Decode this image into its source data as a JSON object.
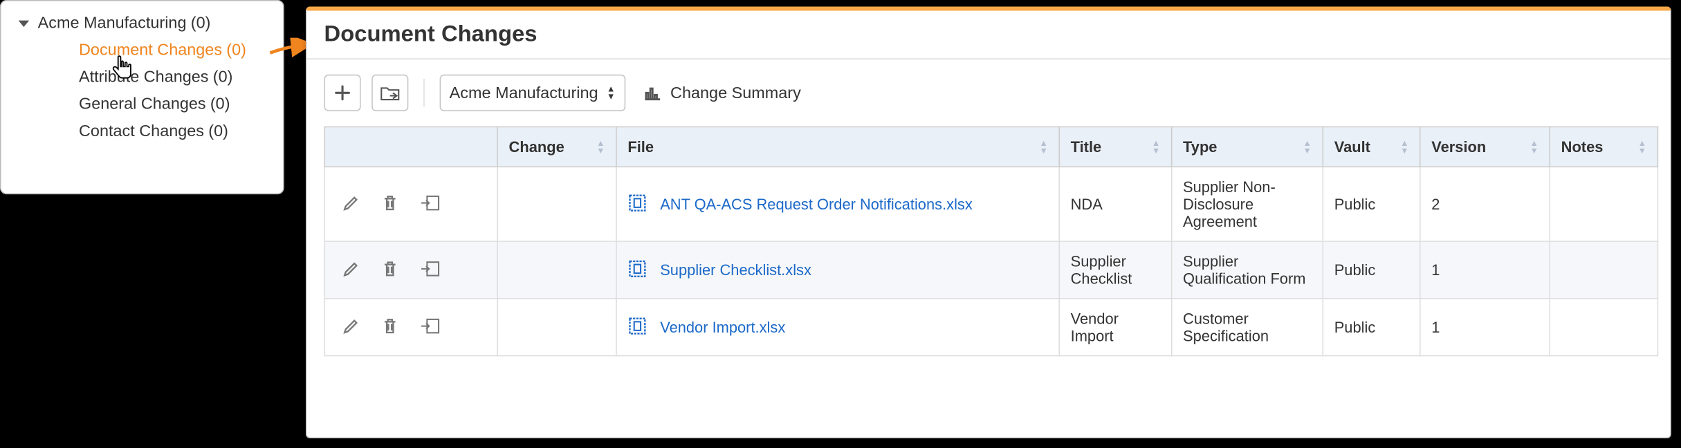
{
  "tree": {
    "root": {
      "label": "Acme Manufacturing",
      "count": "(0)",
      "expanded": true
    },
    "children": [
      {
        "label": "Document Changes",
        "count": "(0)",
        "selected": true
      },
      {
        "label": "Attribute Changes",
        "count": "(0)"
      },
      {
        "label": "General Changes",
        "count": "(0)"
      },
      {
        "label": "Contact Changes",
        "count": "(0)"
      }
    ]
  },
  "main": {
    "title": "Document Changes",
    "toolbar": {
      "select_value": "Acme Manufacturing",
      "summary_label": "Change Summary"
    }
  },
  "columns": {
    "change": "Change",
    "file": "File",
    "title": "Title",
    "type": "Type",
    "vault": "Vault",
    "version": "Version",
    "notes": "Notes"
  },
  "rows": [
    {
      "change": "",
      "file": "ANT QA-ACS Request Order Notifications.xlsx",
      "title": "NDA",
      "type": "Supplier Non-Disclosure Agreement",
      "vault": "Public",
      "version": "2",
      "notes": ""
    },
    {
      "change": "",
      "file": "Supplier Checklist.xlsx",
      "title": "Supplier Checklist",
      "type": "Supplier Qualification Form",
      "vault": "Public",
      "version": "1",
      "notes": ""
    },
    {
      "change": "",
      "file": "Vendor Import.xlsx",
      "title": "Vendor Import",
      "type": "Customer Specification",
      "vault": "Public",
      "version": "1",
      "notes": ""
    }
  ]
}
